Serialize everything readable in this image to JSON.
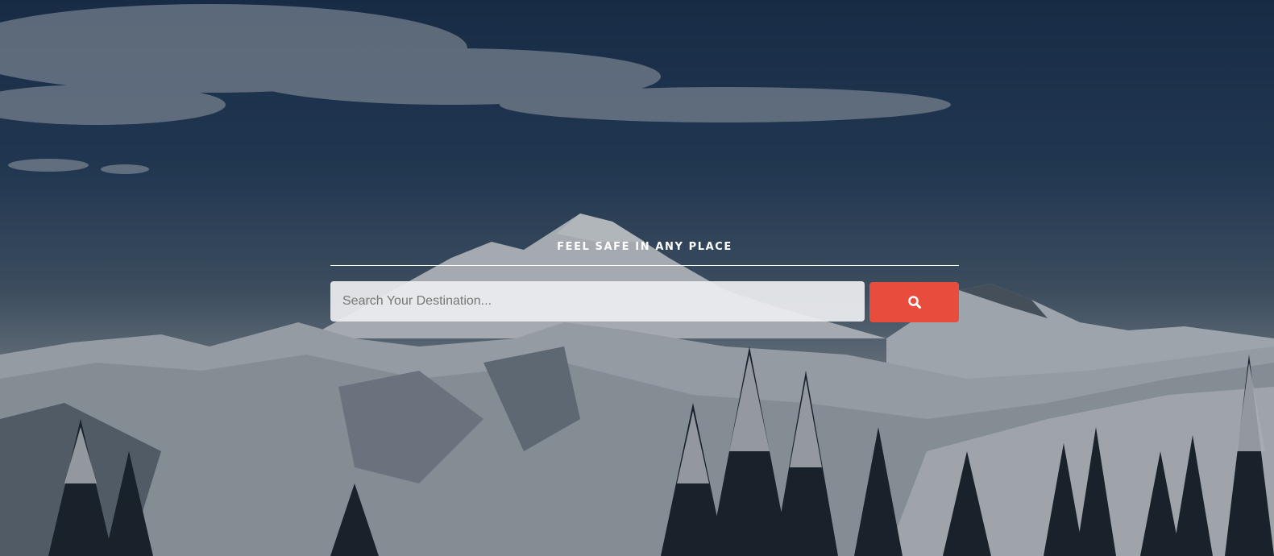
{
  "hero": {
    "tagline": "FEEL SAFE IN ANY PLACE",
    "search": {
      "placeholder": "Search Your Destination...",
      "value": "",
      "button_icon": "search-icon"
    }
  },
  "colors": {
    "accent": "#e84c3d",
    "divider": "#ffffff",
    "sky_dark": "#1d3453"
  }
}
